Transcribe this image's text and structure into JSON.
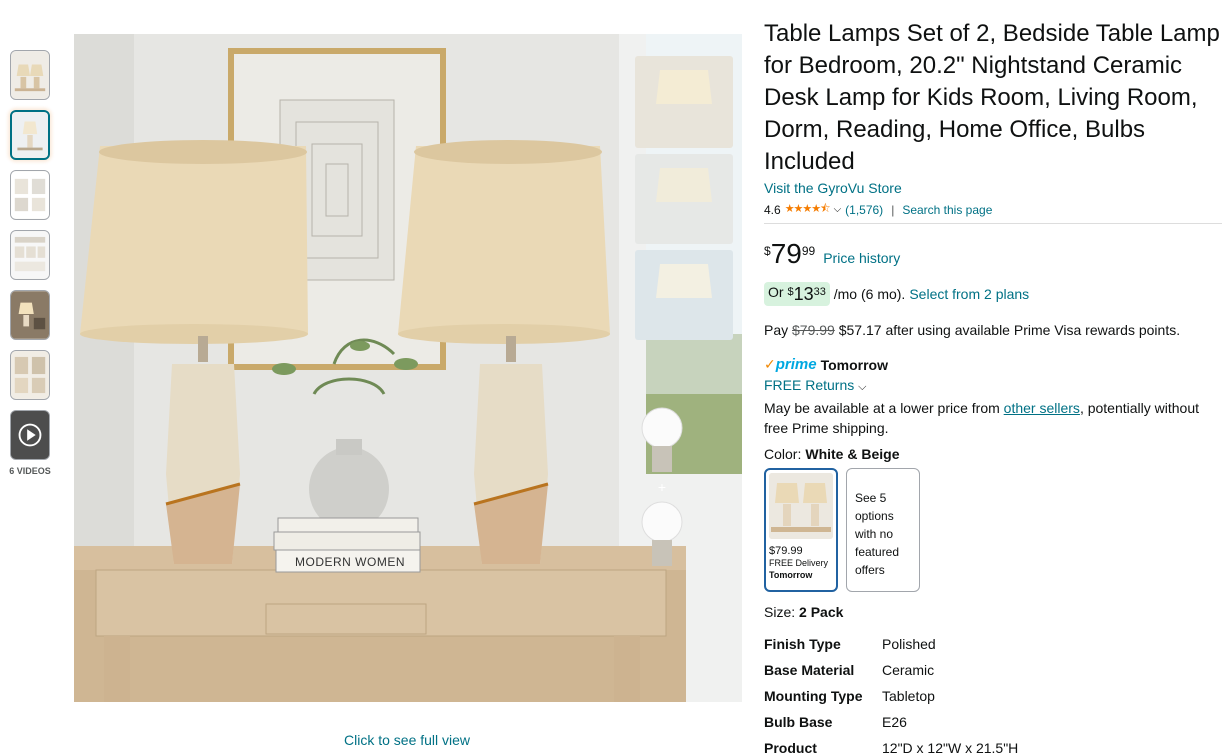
{
  "thumbnails": {
    "items": [
      "image-1",
      "image-2",
      "image-3",
      "image-4",
      "image-5",
      "image-6",
      "video"
    ],
    "videos_label": "6 VIDEOS"
  },
  "main_image": {
    "book_text": "MODERN WOMEN",
    "full_view_label": "Click to see full view"
  },
  "product": {
    "title": "Table Lamps Set of 2, Bedside Table Lamp for Bedroom, 20.2\" Nightstand Ceramic Desk Lamp for Kids Room, Living Room, Dorm, Reading, Home Office, Bulbs Included",
    "store_link": "Visit the GyroVu Store",
    "rating": "4.6",
    "stars": "★★★★⯪",
    "review_count": "(1,576)",
    "search_page": "Search this page"
  },
  "price": {
    "symbol": "$",
    "whole": "79",
    "fraction": "99",
    "history_label": "Price history"
  },
  "monthly": {
    "prefix": "Or ",
    "symbol": "$",
    "whole": "13",
    "fraction": "33",
    "suffix": " /mo (6 mo).",
    "plans_label": "Select from 2 plans"
  },
  "rewards": {
    "prefix": "Pay ",
    "old_price": "$79.99",
    "text": " $57.17 after using available Prime Visa rewards points."
  },
  "prime": {
    "check": "✓",
    "word": "prime",
    "day": "Tomorrow",
    "free_returns": "FREE Returns",
    "lower_prefix": "May be available at a lower price from ",
    "other_sellers": "other sellers",
    "lower_suffix": ", potentially without free Prime shipping."
  },
  "color": {
    "label": "Color:",
    "value": "White & Beige",
    "selected_price": "$79.99",
    "selected_delivery": "FREE Delivery",
    "selected_day": "Tomorrow",
    "other_options": "See 5 options with no featured offers"
  },
  "size": {
    "label": "Size:",
    "value": "2 Pack"
  },
  "specs": [
    {
      "key": "Finish Type",
      "value": "Polished"
    },
    {
      "key": "Base Material",
      "value": "Ceramic"
    },
    {
      "key": "Mounting Type",
      "value": "Tabletop"
    },
    {
      "key": "Bulb Base",
      "value": "E26"
    },
    {
      "key": "Product",
      "value": "12\"D x 12\"W x 21.5\"H"
    }
  ],
  "colors": {
    "link": "#007185",
    "accent_orange": "#f57c00",
    "prime_blue": "#00a8e1",
    "monthly_bg": "#d7f2de",
    "selected_border": "#2162a1"
  }
}
